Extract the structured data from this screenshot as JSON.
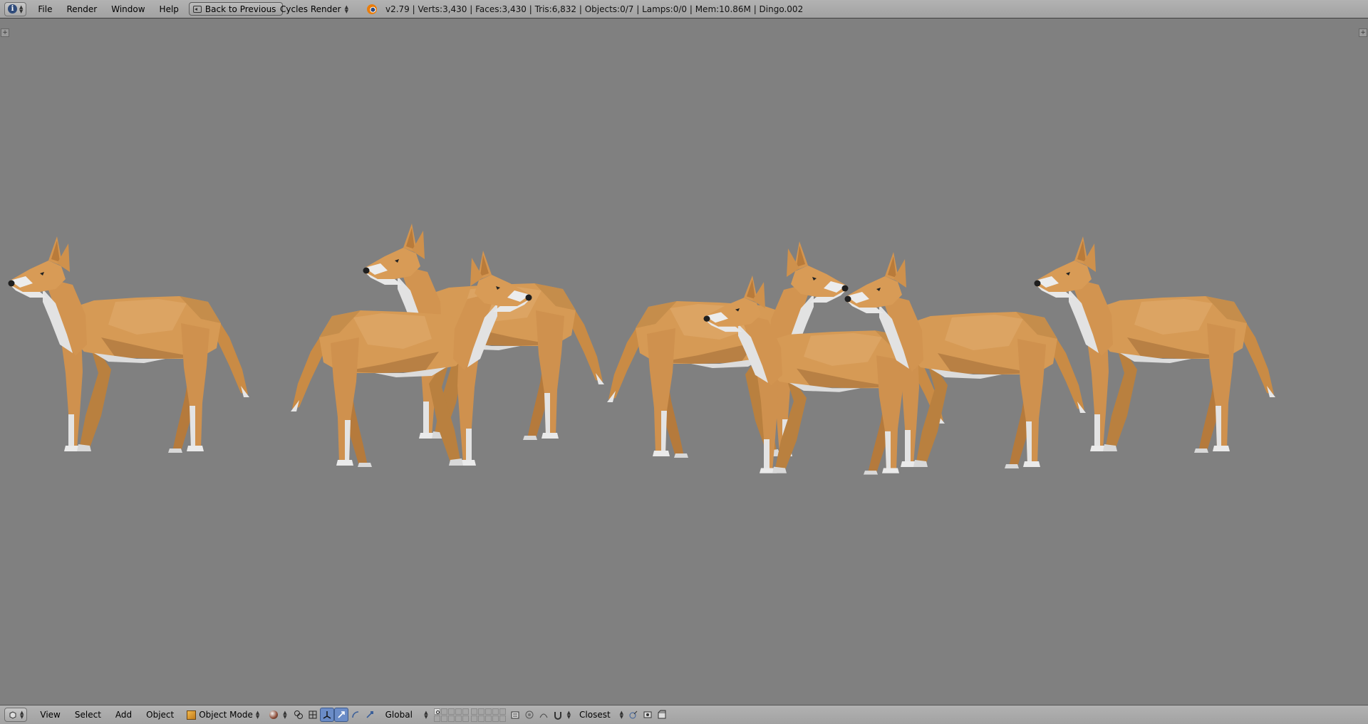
{
  "info_header": {
    "editor_icon": "info-icon",
    "menus": [
      "File",
      "Render",
      "Window",
      "Help"
    ],
    "back_button": "Back to Previous",
    "render_engine": "Cycles Render",
    "stats": "v2.79 | Verts:3,430 | Faces:3,430 | Tris:6,832 | Objects:0/7 | Lamps:0/0 | Mem:10.86M | Dingo.002"
  },
  "viewport": {
    "background": "#808080",
    "objects": [
      "Dingo",
      "Dingo",
      "Dingo",
      "Dingo",
      "Dingo",
      "Dingo",
      "Dingo"
    ]
  },
  "view3d_header": {
    "editor_icon": "3d-view-icon",
    "menus": [
      "View",
      "Select",
      "Add",
      "Object"
    ],
    "mode": "Object Mode",
    "orientation": "Global",
    "snap_target": "Closest",
    "icons": [
      "viewport-shading-icon",
      "pivot-icon",
      "manipulator-icon",
      "translate-icon",
      "rotate-icon",
      "scale-icon",
      "lock-layer-icon",
      "proportional-edit-icon",
      "snap-icon",
      "opengl-render-icon",
      "render-animation-icon"
    ]
  },
  "colors": {
    "header": "#a8a8a8",
    "dingo_fur": "#d69a55",
    "dingo_white": "#dcdcdc",
    "accent": "#5680c2"
  }
}
